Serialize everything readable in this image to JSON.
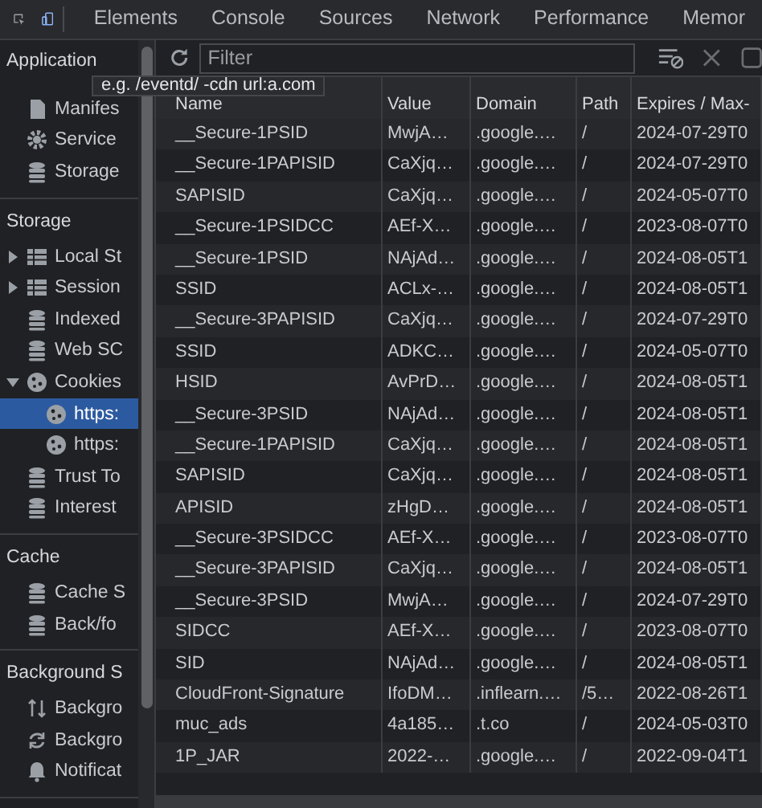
{
  "toolbar": {
    "tabs": [
      {
        "label": "Elements",
        "selected": false
      },
      {
        "label": "Console",
        "selected": false
      },
      {
        "label": "Sources",
        "selected": false
      },
      {
        "label": "Network",
        "selected": false
      },
      {
        "label": "Performance",
        "selected": false
      },
      {
        "label": "Memor",
        "selected": false
      }
    ]
  },
  "sidebar": {
    "sections": [
      {
        "title": "Application",
        "items": [
          {
            "label": "Manifes",
            "kind": "file"
          },
          {
            "label": "Service",
            "kind": "gear"
          },
          {
            "label": "Storage",
            "kind": "database"
          }
        ]
      },
      {
        "title": "Storage",
        "items": [
          {
            "label": "Local St",
            "kind": "grid",
            "expanded": false
          },
          {
            "label": "Session",
            "kind": "grid",
            "expanded": false
          },
          {
            "label": "Indexed",
            "kind": "database"
          },
          {
            "label": "Web SC",
            "kind": "database"
          },
          {
            "label": "Cookies",
            "kind": "cookie",
            "expanded": true,
            "children": [
              {
                "label": "https:",
                "kind": "cookie",
                "selected": true
              },
              {
                "label": "https:",
                "kind": "cookie",
                "selected": false
              }
            ]
          },
          {
            "label": "Trust To",
            "kind": "database"
          },
          {
            "label": "Interest",
            "kind": "database"
          }
        ]
      },
      {
        "title": "Cache",
        "items": [
          {
            "label": "Cache S",
            "kind": "database"
          },
          {
            "label": "Back/fo",
            "kind": "database"
          }
        ]
      },
      {
        "title": "Background S",
        "items": [
          {
            "label": "Backgro",
            "kind": "updown"
          },
          {
            "label": "Backgro",
            "kind": "sync"
          },
          {
            "label": "Notificat",
            "kind": "bell"
          }
        ]
      }
    ]
  },
  "filter": {
    "placeholder": "Filter",
    "tooltip": "e.g. /eventd/ -cdn url:a.com"
  },
  "table": {
    "columns": [
      "Name",
      "Value",
      "Domain",
      "Path",
      "Expires / Max-"
    ],
    "rows": [
      [
        "__Secure-1PSID",
        "MwjA…",
        ".google.…",
        "/",
        "2024-07-29T0"
      ],
      [
        "__Secure-1PAPISID",
        "CaXjq…",
        ".google.…",
        "/",
        "2024-07-29T0"
      ],
      [
        "SAPISID",
        "CaXjq…",
        ".google.…",
        "/",
        "2024-05-07T0"
      ],
      [
        "__Secure-1PSIDCC",
        "AEf-X…",
        ".google.…",
        "/",
        "2023-08-07T0"
      ],
      [
        "__Secure-1PSID",
        "NAjAd…",
        ".google.…",
        "/",
        "2024-08-05T1"
      ],
      [
        "SSID",
        "ACLx-…",
        ".google.…",
        "/",
        "2024-08-05T1"
      ],
      [
        "__Secure-3PAPISID",
        "CaXjq…",
        ".google.…",
        "/",
        "2024-07-29T0"
      ],
      [
        "SSID",
        "ADKC…",
        ".google.…",
        "/",
        "2024-05-07T0"
      ],
      [
        "HSID",
        "AvPrD…",
        ".google.…",
        "/",
        "2024-08-05T1"
      ],
      [
        "__Secure-3PSID",
        "NAjAd…",
        ".google.…",
        "/",
        "2024-08-05T1"
      ],
      [
        "__Secure-1PAPISID",
        "CaXjq…",
        ".google.…",
        "/",
        "2024-08-05T1"
      ],
      [
        "SAPISID",
        "CaXjq…",
        ".google.…",
        "/",
        "2024-08-05T1"
      ],
      [
        "APISID",
        "zHgD…",
        ".google.…",
        "/",
        "2024-08-05T1"
      ],
      [
        "__Secure-3PSIDCC",
        "AEf-X…",
        ".google.…",
        "/",
        "2023-08-07T0"
      ],
      [
        "__Secure-3PAPISID",
        "CaXjq…",
        ".google.…",
        "/",
        "2024-08-05T1"
      ],
      [
        "__Secure-3PSID",
        "MwjA…",
        ".google.…",
        "/",
        "2024-07-29T0"
      ],
      [
        "SIDCC",
        "AEf-X…",
        ".google.…",
        "/",
        "2023-08-07T0"
      ],
      [
        "SID",
        "NAjAd…",
        ".google.…",
        "/",
        "2024-08-05T1"
      ],
      [
        "CloudFront-Signature",
        "IfoDM…",
        ".inflearn.…",
        "/5…",
        "2022-08-26T1"
      ],
      [
        "muc_ads",
        "4a185…",
        ".t.co",
        "/",
        "2024-05-03T0"
      ],
      [
        "1P_JAR",
        "2022-…",
        ".google.…",
        "/",
        "2022-09-04T1"
      ]
    ]
  }
}
